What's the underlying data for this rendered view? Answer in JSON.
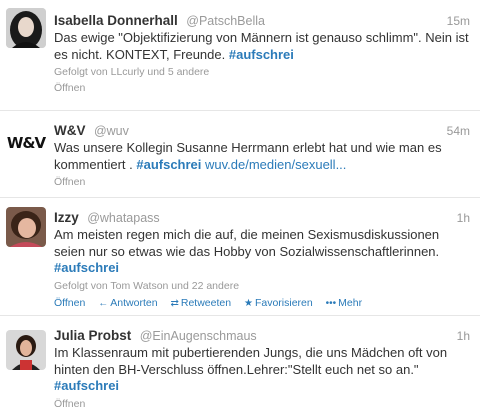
{
  "tweets": [
    {
      "name": "Isabella Donnerhall",
      "handle": "@PatschBella",
      "time": "15m",
      "text_before": "Das ewige \"Objektifizierung von Männern ist genauso schlimm\". Nein ist es nicht. KONTEXT, Freunde. ",
      "hashtag": "#aufschrei",
      "meta": "Gefolgt von LLcurly und 5 andere",
      "open_label": "Öffnen"
    },
    {
      "name": "W&V",
      "handle": "@wuv",
      "time": "54m",
      "text_before": "Was unsere Kollegin Susanne Herrmann erlebt hat und wie man es kommentiert . ",
      "hashtag": "#aufschrei",
      "link": " wuv.de/medien/sexuell...",
      "open_label": "Öffnen",
      "avatar_text": "W&V"
    },
    {
      "name": "Izzy",
      "handle": "@whatapass",
      "time": "1h",
      "text_before": "Am meisten regen mich die auf, die meinen Sexismusdiskussionen seien nur so etwas wie das Hobby von Sozialwissenschaftlerinnen. ",
      "hashtag": "#aufschrei",
      "meta": "Gefolgt von Tom Watson und 22 andere",
      "actions": {
        "open": "Öffnen",
        "reply": "Antworten",
        "retweet": "Retweeten",
        "favorite": "Favorisieren",
        "more": "Mehr"
      }
    },
    {
      "name": "Julia Probst",
      "handle": "@EinAugenschmaus",
      "time": "1h",
      "text_before": "Im Klassenraum mit pubertierenden Jungs, die uns Mädchen oft von hinten den BH-Verschluss öffnen.Lehrer:\"Stellt euch net so an.\" ",
      "hashtag": "#aufschrei",
      "open_label": "Öffnen"
    }
  ],
  "colors": {
    "link": "#2b7bb9",
    "meta": "#999999",
    "text": "#333333"
  }
}
